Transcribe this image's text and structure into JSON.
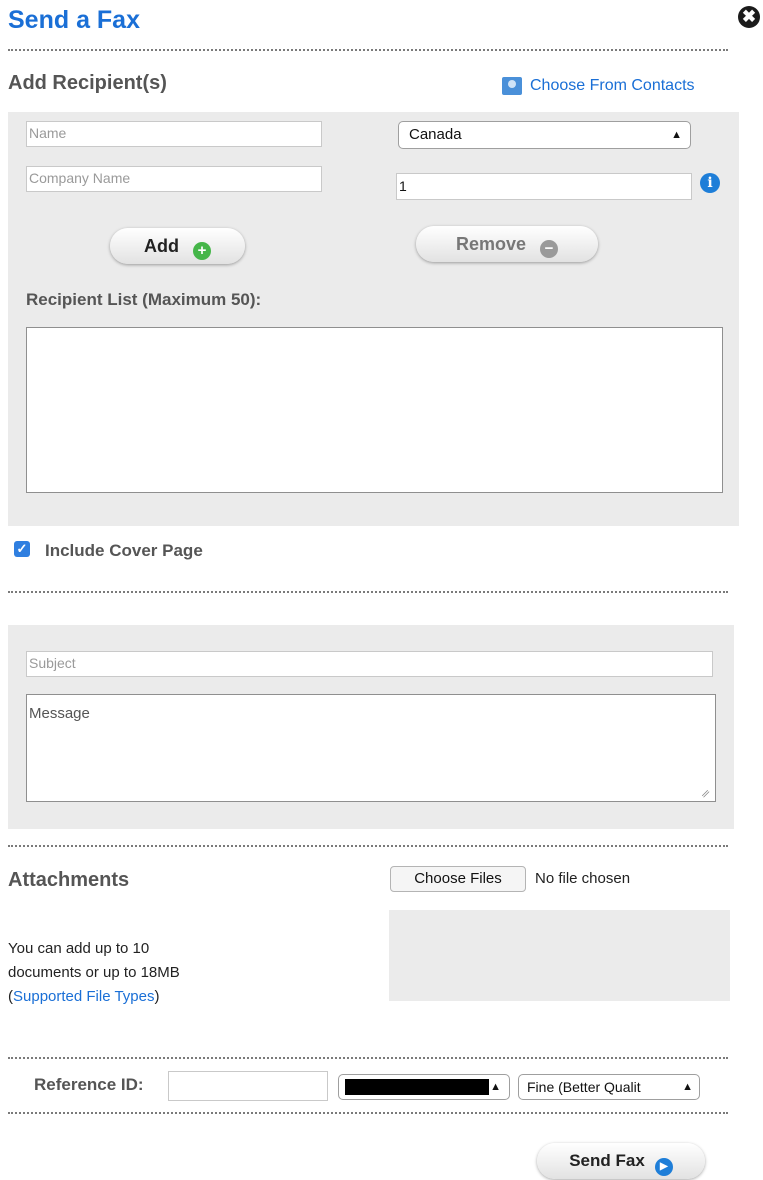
{
  "header": {
    "title": "Send a Fax",
    "close_glyph": "✖"
  },
  "recipients": {
    "heading": "Add Recipient(s)",
    "choose_contacts": "Choose From Contacts",
    "name_placeholder": "Name",
    "company_placeholder": "Company Name",
    "country_value": "Canada",
    "fax_number_value": "1",
    "add_label": "Add",
    "remove_label": "Remove",
    "list_label": "Recipient List (Maximum 50):"
  },
  "cover": {
    "include_label": "Include Cover Page",
    "checked": true,
    "subject_placeholder": "Subject",
    "message_placeholder": "Message"
  },
  "attachments": {
    "heading": "Attachments",
    "choose_files_label": "Choose Files",
    "no_file_text": "No file chosen",
    "help_line1": "You can add up to 10",
    "help_line2": "documents or up to 18MB",
    "help_open": "(",
    "supported_link": "Supported File Types",
    "help_close": ")"
  },
  "footer": {
    "reference_label": "Reference ID:",
    "reference_value": "",
    "quality_value": "Fine (Better Qualit",
    "send_label": "Send Fax"
  },
  "colors": {
    "accent": "#1a6fd6",
    "panel": "#ebebeb"
  },
  "icons": [
    "close-icon",
    "contacts-icon",
    "info-icon",
    "plus-icon",
    "minus-icon",
    "checkmark-icon",
    "arrow-right-icon"
  ]
}
